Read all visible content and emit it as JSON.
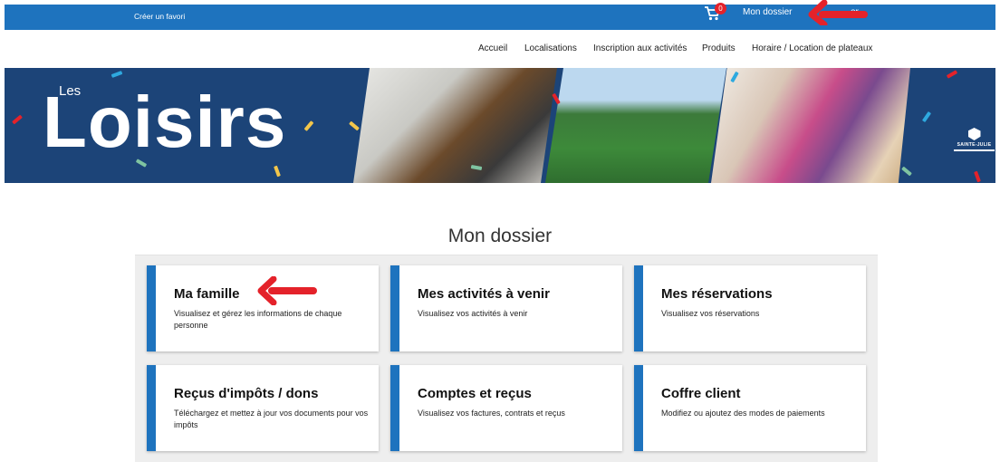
{
  "topbar": {
    "favorite_label": "Créer un favori",
    "cart_count": "0",
    "my_file_label": "Mon dossier",
    "logout_label_partial": "er"
  },
  "nav": {
    "items": [
      {
        "label": "Accueil"
      },
      {
        "label": "Localisations"
      },
      {
        "label": "Inscription aux activités"
      },
      {
        "label": "Produits"
      },
      {
        "label": "Horaire / Location de plateaux"
      }
    ]
  },
  "banner": {
    "small_title": "Les",
    "title": "Loisirs",
    "brand_name": "SAINTE-JULIE",
    "background_color": "#1c4478"
  },
  "main": {
    "title": "Mon dossier",
    "cards": [
      {
        "title": "Ma famille",
        "description": "Visualisez et gérez les informations de chaque personne"
      },
      {
        "title": "Mes activités à venir",
        "description": "Visualisez vos activités à venir"
      },
      {
        "title": "Mes réservations",
        "description": "Visualisez vos réservations"
      },
      {
        "title": "Reçus d'impôts / dons",
        "description": "Téléchargez et mettez à jour vos documents pour vos impôts"
      },
      {
        "title": "Comptes et reçus",
        "description": "Visualisez vos factures, contrats et reçus"
      },
      {
        "title": "Coffre client",
        "description": "Modifiez ou ajoutez des modes de paiements"
      }
    ]
  },
  "colors": {
    "accent": "#1e73be",
    "annotation_arrow": "#e4222a"
  }
}
